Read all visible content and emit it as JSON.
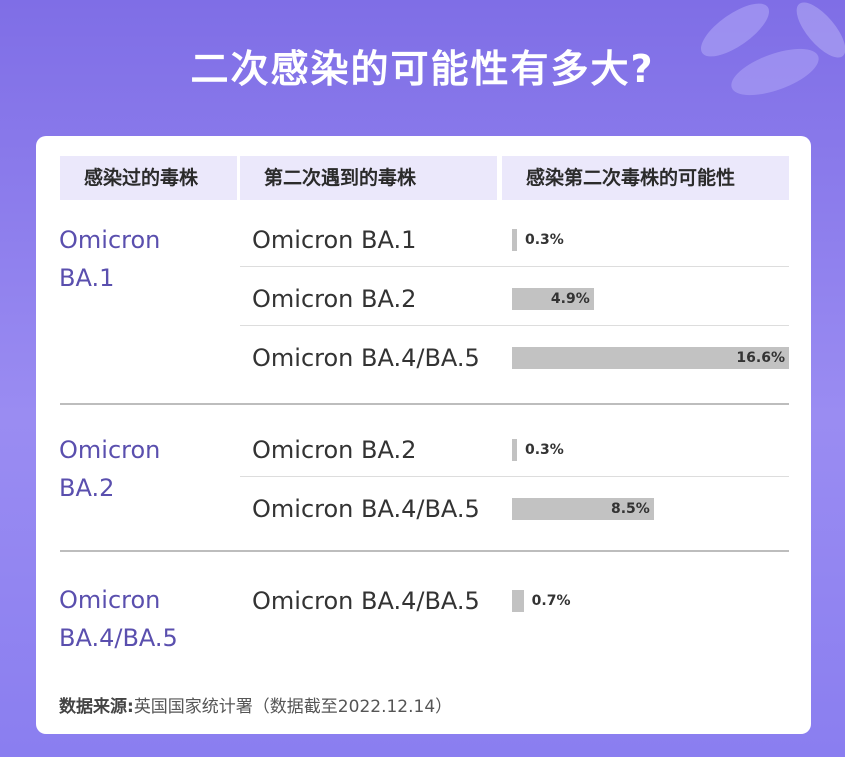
{
  "title": "二次感染的可能性有多大?",
  "headers": [
    "感染过的毒株",
    "第二次遇到的毒株",
    "感染第二次毒株的可能性"
  ],
  "groups": [
    {
      "label": "Omicron BA.1",
      "rows": [
        {
          "variant": "Omicron BA.1",
          "value": 0.3,
          "value_label": "0.3%"
        },
        {
          "variant": "Omicron BA.2",
          "value": 4.9,
          "value_label": "4.9%"
        },
        {
          "variant": "Omicron BA.4/BA.5",
          "value": 16.6,
          "value_label": "16.6%"
        }
      ]
    },
    {
      "label": "Omicron BA.2",
      "rows": [
        {
          "variant": "Omicron BA.2",
          "value": 0.3,
          "value_label": "0.3%"
        },
        {
          "variant": "Omicron BA.4/BA.5",
          "value": 8.5,
          "value_label": "8.5%"
        }
      ]
    },
    {
      "label": "Omicron BA.4/BA.5",
      "rows": [
        {
          "variant": "Omicron BA.4/BA.5",
          "value": 0.7,
          "value_label": "0.7%"
        }
      ]
    }
  ],
  "source_label": "数据来源:",
  "source_text": "英国国家统计署（数据截至2022.12.14）",
  "colors": {
    "background": "#8a7ef0",
    "header_bg": "#ebe8fb",
    "bar": "#c2c2c2",
    "group_label": "#5a4fae"
  },
  "chart_data": {
    "type": "bar",
    "orientation": "horizontal",
    "title": "二次感染的可能性有多大?",
    "categories": [
      "Omicron BA.1 → Omicron BA.1",
      "Omicron BA.1 → Omicron BA.2",
      "Omicron BA.1 → Omicron BA.4/BA.5",
      "Omicron BA.2 → Omicron BA.2",
      "Omicron BA.2 → Omicron BA.4/BA.5",
      "Omicron BA.4/BA.5 → Omicron BA.4/BA.5"
    ],
    "values": [
      0.3,
      4.9,
      16.6,
      0.3,
      8.5,
      0.7
    ],
    "unit": "%",
    "xlim": [
      0,
      16.6
    ],
    "grid": false
  }
}
